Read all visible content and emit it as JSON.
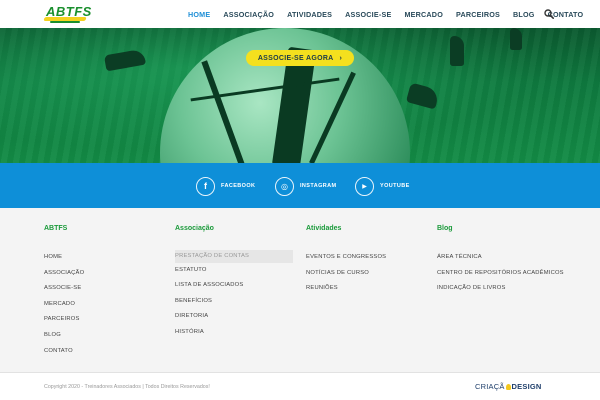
{
  "header": {
    "logo_text": "ABTFS",
    "nav": [
      "HOME",
      "ASSOCIAÇÃO",
      "ATIVIDADES",
      "ASSOCIE-SE",
      "MERCADO",
      "PARCEIROS",
      "BLOG",
      "CONTATO"
    ],
    "active_nav": "HOME",
    "search_icon": "search-icon"
  },
  "hero": {
    "cta_label": "ASSOCIE-SE AGORA",
    "cta_arrow": "›"
  },
  "social": {
    "items": [
      {
        "icon": "facebook-icon",
        "glyph": "f",
        "label": "FACEBOOK"
      },
      {
        "icon": "instagram-icon",
        "glyph": "◎",
        "label": "INSTAGRAM"
      },
      {
        "icon": "youtube-icon",
        "glyph": "▶",
        "label": "YOUTUBE"
      }
    ]
  },
  "footer": {
    "columns": [
      {
        "title": "ABTFS",
        "links": [
          "HOME",
          "ASSOCIAÇÃO",
          "ASSOCIE-SE",
          "MERCADO",
          "PARCEIROS",
          "BLOG",
          "CONTATO"
        ]
      },
      {
        "title": "Associação",
        "links": [
          "PRESTAÇÃO DE CONTAS",
          "ESTATUTO",
          "LISTA DE ASSOCIADOS",
          "BENEFÍCIOS",
          "DIRETORIA",
          "HISTÓRIA"
        ]
      },
      {
        "title": "Atividades",
        "links": [
          "EVENTOS E CONGRESSOS",
          "NOTÍCIAS DE CURSO",
          "REUNIÕES"
        ]
      },
      {
        "title": "Blog",
        "links": [
          "ÁREA TÉCNICA",
          "CENTRO DE REPOSITÓRIOS ACADÊMICOS",
          "INDICAÇÃO DE LIVROS"
        ]
      }
    ],
    "highlighted_link": "PRESTAÇÃO DE CONTAS"
  },
  "bottom": {
    "copyright": "Copyright 2020 - Treinadores Associados | Todos Direitos Reservados!",
    "credit_part1": "CRIAÇÃ",
    "credit_part2": "DESIGN"
  },
  "colors": {
    "brand_green": "#1a9a3a",
    "nav_active": "#1f8fd6",
    "social_bar": "#0e8fd8",
    "cta_yellow": "#f4e01e"
  }
}
